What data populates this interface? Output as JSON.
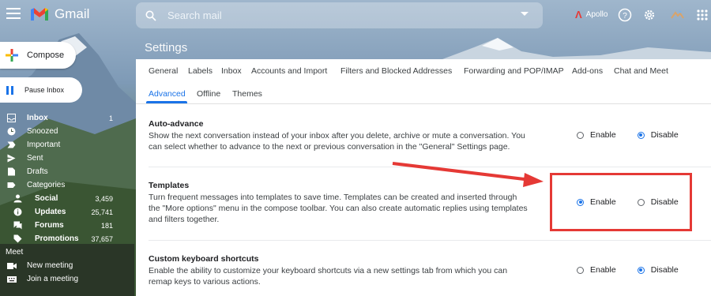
{
  "app": {
    "name": "Gmail"
  },
  "header": {
    "search_placeholder": "Search mail",
    "apollo_label": "Apollo",
    "help_icon": "help-icon",
    "settings_icon": "gear-icon",
    "apps_icon": "apps-grid-icon"
  },
  "compose": {
    "label": "Compose"
  },
  "pause": {
    "label": "Pause Inbox"
  },
  "nav": {
    "inbox": {
      "label": "Inbox",
      "count": "1"
    },
    "snoozed": {
      "label": "Snoozed"
    },
    "important": {
      "label": "Important"
    },
    "sent": {
      "label": "Sent"
    },
    "drafts": {
      "label": "Drafts"
    },
    "categories": {
      "label": "Categories"
    },
    "social": {
      "label": "Social",
      "count": "3,459"
    },
    "updates": {
      "label": "Updates",
      "count": "25,741"
    },
    "forums": {
      "label": "Forums",
      "count": "181"
    },
    "promotions": {
      "label": "Promotions",
      "count": "37,657"
    }
  },
  "meet": {
    "title": "Meet",
    "new_meeting": "New meeting",
    "join_meeting": "Join a meeting"
  },
  "settings": {
    "title": "Settings",
    "tabs_row1": [
      "General",
      "Labels",
      "Inbox",
      "Accounts and Import",
      "Filters and Blocked Addresses",
      "Forwarding and POP/IMAP",
      "Add-ons",
      "Chat and Meet"
    ],
    "tabs_row2": [
      "Advanced",
      "Offline",
      "Themes"
    ],
    "active_tab": "Advanced",
    "sections": {
      "auto_advance": {
        "title": "Auto-advance",
        "description": "Show the next conversation instead of your inbox after you delete, archive or mute a conversation. You can select whether to advance to the next or previous conversation in the \"General\" Settings page.",
        "enable_label": "Enable",
        "disable_label": "Disable",
        "selected": "Disable"
      },
      "templates": {
        "title": "Templates",
        "description": "Turn frequent messages into templates to save time. Templates can be created and inserted through the \"More options\" menu in the compose toolbar. You can also create automatic replies using templates and filters together.",
        "enable_label": "Enable",
        "disable_label": "Disable",
        "selected": "Enable"
      },
      "keyboard_shortcuts": {
        "title": "Custom keyboard shortcuts",
        "description": "Enable the ability to customize your keyboard shortcuts via a new settings tab from which you can remap keys to various actions.",
        "enable_label": "Enable",
        "disable_label": "Disable",
        "selected": "Disable"
      }
    }
  },
  "colors": {
    "accent": "#1a73e8",
    "annotation": "#e53935"
  }
}
